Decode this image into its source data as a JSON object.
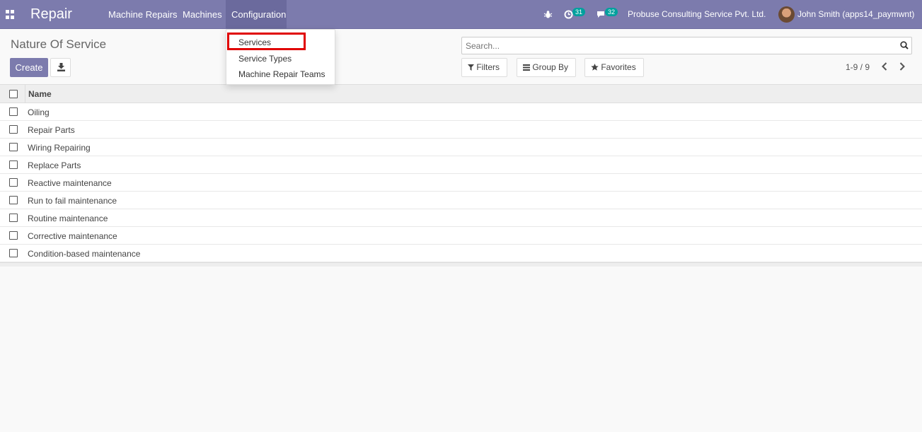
{
  "navbar": {
    "brand": "Repair",
    "menus": [
      "Machine Repairs",
      "Machines",
      "Configuration"
    ],
    "activities_count": "31",
    "messages_count": "32",
    "company": "Probuse Consulting Service Pvt. Ltd.",
    "user": "John Smith (apps14_paymwnt)"
  },
  "dropdown": {
    "items": [
      "Services",
      "Service Types",
      "Machine Repair Teams"
    ],
    "highlighted": "Services"
  },
  "control_panel": {
    "title": "Nature Of Service",
    "create_label": "Create",
    "search_placeholder": "Search...",
    "filters_label": "Filters",
    "group_by_label": "Group By",
    "favorites_label": "Favorites",
    "pager": "1-9 / 9"
  },
  "table": {
    "column": "Name",
    "rows": [
      "Oiling",
      "Repair Parts",
      "Wiring Repairing",
      "Replace Parts",
      "Reactive maintenance",
      "Run to fail maintenance",
      "Routine maintenance",
      "Corrective maintenance",
      "Condition-based maintenance"
    ]
  },
  "colors": {
    "brand": "#7c7bad",
    "badge": "#00a09d",
    "highlight": "#e00000"
  }
}
